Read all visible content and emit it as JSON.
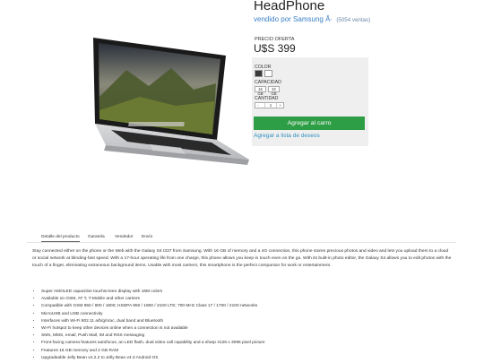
{
  "product": {
    "title": "HeadPhone",
    "vendor_prefix": "vendido por",
    "vendor_name": "Samsung Â·",
    "sales_count": "(5054 ventas)"
  },
  "pricing": {
    "label": "PRECIO OFERTA",
    "value": "U$S 399"
  },
  "options": {
    "color_label": "COLOR",
    "colors": [
      "#3a3a3a",
      "#ffffff"
    ],
    "capacity_label": "CAPACIDAD",
    "capacities": [
      "16 GB",
      "32 GB"
    ],
    "quantity_label": "CANTIDAD",
    "quantity_minus": "-",
    "quantity_value": "1",
    "quantity_plus": "+"
  },
  "actions": {
    "add_to_cart": "Agregar al carro",
    "wishlist": "Agregar a lista de deseos"
  },
  "tabs": [
    {
      "label": "Detalle del producto",
      "active": true
    },
    {
      "label": "Garantía",
      "active": false
    },
    {
      "label": "Vendedor",
      "active": false
    },
    {
      "label": "Envío",
      "active": false
    }
  ],
  "description": "Stay connected either on the phone or the Web with the Galaxy S4 I337 from Samsung. With 16 GB of memory and a 4G connection, this phone stores precious photos and video and lets you upload them to a cloud or social network at blinding-fast speed. With a 17-hour operating life from one charge, this phone allows you keep in touch even on the go. With its built-in photo editor, the Galaxy S4 allows you to edit photos with the touch of a finger, eliminating extraneous background items. Usable with most carriers, this smartphone is the perfect companion for work or entertainment.",
  "specs": [
    "Super AMOLED capacitive touchscreen display with 16M colors",
    "Available on GSM, AT T, T-Mobile and other carriers",
    "Compatible with GSM 850 / 900 / 1800; HSDPA 850 / 1900 / 2100 LTE; 700 MHz Class 17 / 1700 / 2100 networks",
    "MicroUSB and USB connectivity",
    "Interfaces with Wi-Fi 802.11 a/b/g/n/ac, dual band and Bluetooth",
    "Wi-Fi hotspot to keep other devices online when a connection is not available",
    "SMS, MMS, email, Push Mail, IM and RSS messaging",
    "Front-facing camera features autofocus, an LED flash, dual video call capability and a sharp 4128 x 3096 pixel picture",
    "Features 16 GB memory and 2 GB RAM",
    "Upgradeable Jelly Bean v4.2.2 to Jelly Bean v4.3 Android OS"
  ]
}
